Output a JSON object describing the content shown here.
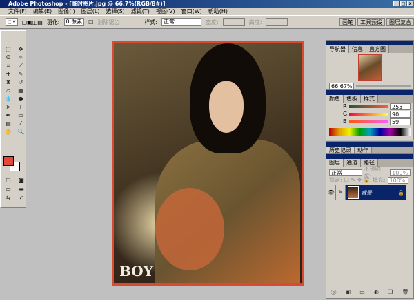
{
  "title": "Adobe Photoshop - [临时图片.jpg @ 66.7%(RGB/8#)]",
  "menu": [
    "文件(F)",
    "编辑(E)",
    "图像(I)",
    "图层(L)",
    "选择(S)",
    "滤镜(T)",
    "视图(V)",
    "窗口(W)",
    "帮助(H)"
  ],
  "options": {
    "feather_label": "羽化:",
    "feather_value": "0 像素",
    "antialias": "消除锯齿",
    "style_label": "样式:",
    "style_value": "正常",
    "width_label": "宽度:",
    "height_label": "高度:"
  },
  "palette_well": [
    "画笔",
    "工具预设",
    "图层复合"
  ],
  "navigator": {
    "tabs": [
      "导航器",
      "信息",
      "直方图"
    ],
    "zoom": "66.67%"
  },
  "color": {
    "tabs": [
      "颜色",
      "色板",
      "样式"
    ],
    "r_label": "R",
    "g_label": "G",
    "b_label": "B",
    "r": "255",
    "g": "90",
    "b": "59",
    "fg": "#e7473a"
  },
  "history": {
    "tabs": [
      "历史记录",
      "动作"
    ]
  },
  "layers": {
    "tabs": [
      "图层",
      "通道",
      "路径"
    ],
    "blend": "正常",
    "opacity_label": "不透明度:",
    "opacity": "100%",
    "lock_label": "锁定:",
    "fill_label": "填充:",
    "fill": "100%",
    "layer_name": "背景"
  },
  "logo": "BOY"
}
